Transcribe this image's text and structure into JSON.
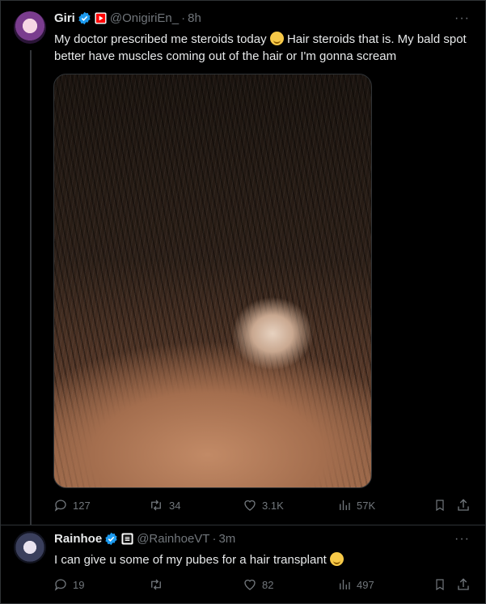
{
  "tweet": {
    "name": "Giri",
    "handle": "@OnigiriEn_",
    "time": "8h",
    "text_before_emoji": "My doctor prescribed me steroids today ",
    "text_after_emoji": " Hair steroids that is.  My bald spot better have muscles coming out of the hair or I'm gonna scream",
    "emoji": "relieved-face",
    "media": "photo of a bald spot on scalp hair",
    "replies": "127",
    "retweets": "34",
    "likes": "3.1K",
    "views": "57K"
  },
  "reply": {
    "name": "Rainhoe",
    "handle": "@RainhoeVT",
    "time": "3m",
    "text_before_emoji": "I can give u some of my pubes for a hair transplant ",
    "emoji": "pleading-face",
    "replies": "19",
    "retweets": "",
    "likes": "82",
    "views": "497"
  },
  "colors": {
    "background": "#000000",
    "text": "#e7e9ea",
    "muted": "#71767b",
    "verified": "#1d9bf0",
    "youtube": "#ff0000",
    "border": "#2f3336"
  }
}
